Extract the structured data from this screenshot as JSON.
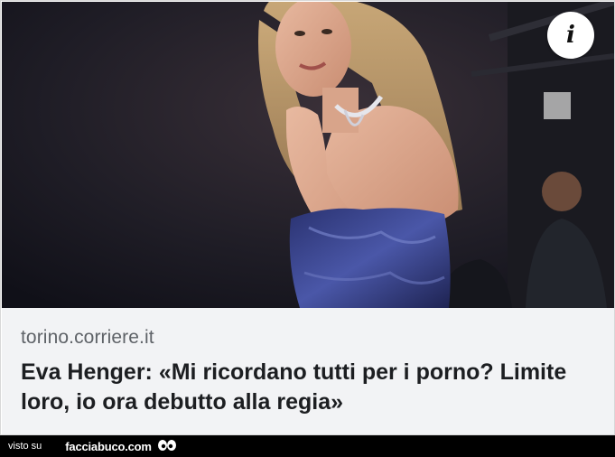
{
  "post": {
    "info_icon": "info-icon",
    "info_glyph": "i",
    "domain": "torino.corriere.it",
    "headline": "Eva Henger: «Mi ricordano tutti per i porno? Limite loro, io ora debutto alla regia»"
  },
  "footer": {
    "visto_su": "visto su",
    "brand": "facciabuco.com",
    "logo_icon": "eyes-icon"
  },
  "colors": {
    "meta_background": "#f2f3f5",
    "domain_text": "#5f6368",
    "headline_text": "#1c1e21",
    "footer_background": "#000000"
  }
}
